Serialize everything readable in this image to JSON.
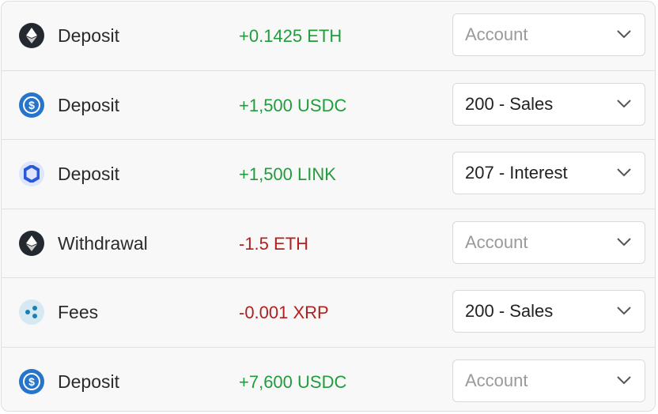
{
  "rows": [
    {
      "icon": "ethereum-icon",
      "type": "Deposit",
      "amount": "+0.1425 ETH",
      "direction": "positive",
      "account": "",
      "account_placeholder": "Account"
    },
    {
      "icon": "usdc-icon",
      "type": "Deposit",
      "amount": "+1,500 USDC",
      "direction": "positive",
      "account": "200 - Sales",
      "account_placeholder": "Account"
    },
    {
      "icon": "chainlink-icon",
      "type": "Deposit",
      "amount": "+1,500 LINK",
      "direction": "positive",
      "account": "207 - Interest",
      "account_placeholder": "Account"
    },
    {
      "icon": "ethereum-icon",
      "type": "Withdrawal",
      "amount": "-1.5 ETH",
      "direction": "negative",
      "account": "",
      "account_placeholder": "Account"
    },
    {
      "icon": "xrp-icon",
      "type": "Fees",
      "amount": "-0.001 XRP",
      "direction": "negative",
      "account": "200 - Sales",
      "account_placeholder": "Account"
    },
    {
      "icon": "usdc-icon",
      "type": "Deposit",
      "amount": "+7,600 USDC",
      "direction": "positive",
      "account": "",
      "account_placeholder": "Account"
    }
  ],
  "colors": {
    "positive": "#1f9d3b",
    "negative": "#b31e1e",
    "placeholder": "#9a9a9a"
  }
}
